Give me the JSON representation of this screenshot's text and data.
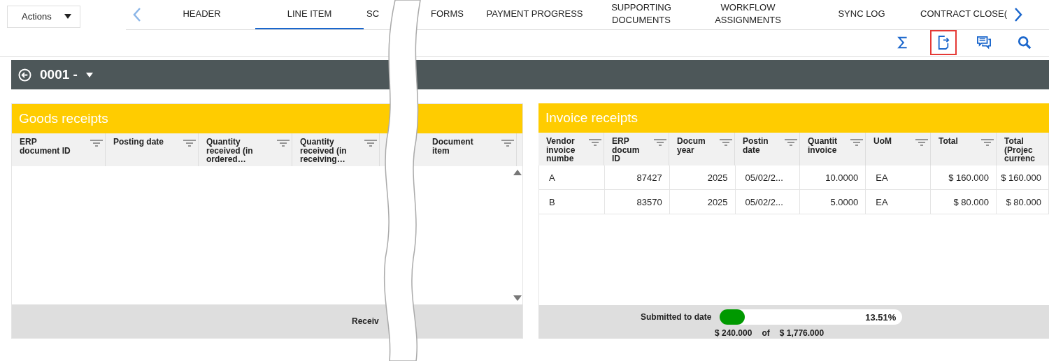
{
  "actions": {
    "label": "Actions"
  },
  "tabs": [
    {
      "label": "HEADER",
      "selected": false
    },
    {
      "label": "LINE ITEM",
      "selected": true
    },
    {
      "label": "SC",
      "selected": false
    },
    {
      "label": "FORMS",
      "selected": false
    },
    {
      "label": "PAYMENT PROGRESS",
      "selected": false
    },
    {
      "label": "SUPPORTING DOCUMENTS",
      "selected": false
    },
    {
      "label": "WORKFLOW ASSIGNMENTS",
      "selected": false
    },
    {
      "label": "SYNC LOG",
      "selected": false
    },
    {
      "label": "CONTRACT CLOSE(",
      "selected": false
    }
  ],
  "toolbar": [
    {
      "kind": "sum",
      "highlighted": false
    },
    {
      "kind": "export",
      "highlighted": true
    },
    {
      "kind": "comments",
      "highlighted": false
    },
    {
      "kind": "search",
      "highlighted": false
    }
  ],
  "record": {
    "title": "0001 -"
  },
  "goods_receipts": {
    "title": "Goods receipts",
    "columns": [
      {
        "lines": [
          "ERP",
          "document ID"
        ]
      },
      {
        "lines": [
          "Posting date"
        ]
      },
      {
        "lines": [
          "Quantity",
          "received (in",
          "ordered…"
        ]
      },
      {
        "lines": [
          "Quantity",
          "received (in",
          "receiving…"
        ]
      },
      {
        "lines": [
          "Document",
          "item"
        ]
      }
    ],
    "footer": "Receiv"
  },
  "invoice_receipts": {
    "title": "Invoice receipts",
    "columns": [
      {
        "lines": [
          "Vendor",
          "invoice",
          "numbe"
        ],
        "filter": true
      },
      {
        "lines": [
          "ERP",
          "docum",
          "ID"
        ],
        "filter": true
      },
      {
        "lines": [
          "Docum",
          "year"
        ],
        "filter": true
      },
      {
        "lines": [
          "Postin",
          "date"
        ],
        "filter": true
      },
      {
        "lines": [
          "Quantit",
          "invoice"
        ],
        "filter": true
      },
      {
        "lines": [
          "UoM"
        ],
        "filter": true
      },
      {
        "lines": [
          "Total"
        ],
        "filter": true
      },
      {
        "lines": [
          "Total",
          "(Projec",
          "currenc"
        ],
        "filter": false
      }
    ],
    "rows": [
      [
        "A",
        "87427",
        "2025",
        "05/02/2...",
        "10.0000",
        "EA",
        "$ 160.000",
        "$ 160.000"
      ],
      [
        "B",
        "83570",
        "2025",
        "05/02/2...",
        "5.0000",
        "EA",
        "$ 80.000",
        "$ 80.000"
      ]
    ],
    "progress": {
      "label": "Submitted to date",
      "level": 0.1351,
      "percent": "13.51%",
      "submitted": "$ 240.000",
      "of": "of",
      "total": "$ 1,776.000"
    }
  }
}
